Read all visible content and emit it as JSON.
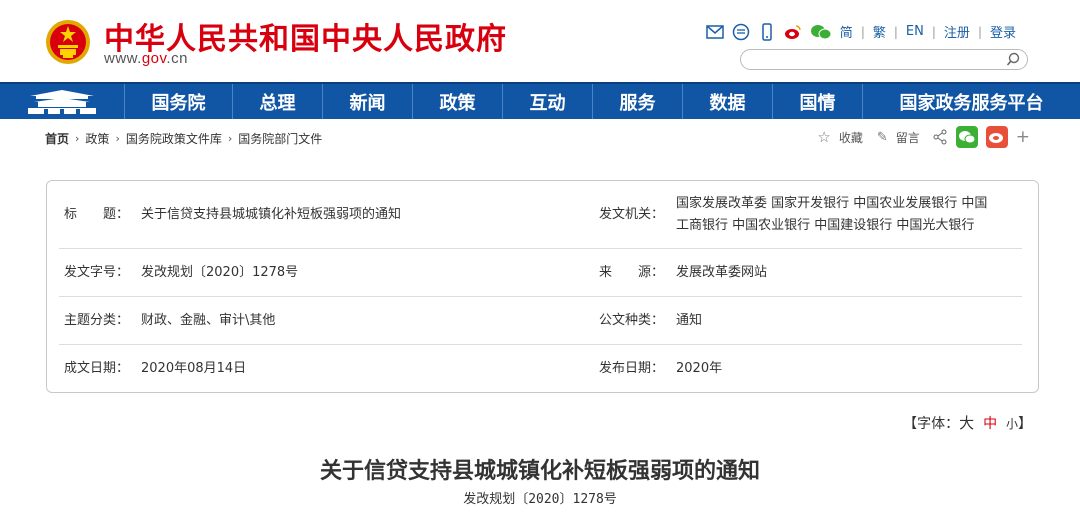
{
  "site": {
    "title": "中华人民共和国中央人民政府",
    "url_prefix": "www.",
    "url_gov": "gov",
    "url_suffix": ".cn",
    "brand_red": "#d8000f",
    "nav_blue": "#1156a5"
  },
  "toplinks": {
    "icons": [
      "mail-icon",
      "message-icon",
      "mobile-icon",
      "weibo-icon",
      "wechat-icon"
    ],
    "simplified": "简",
    "traditional": "繁",
    "english": "EN",
    "register": "注册",
    "login": "登录"
  },
  "search": {
    "placeholder": ""
  },
  "nav": {
    "items": [
      "国务院",
      "总理",
      "新闻",
      "政策",
      "互动",
      "服务",
      "数据",
      "国情",
      "国家政务服务平台"
    ]
  },
  "breadcrumb": [
    "首页",
    "政策",
    "国务院政策文件库",
    "国务院部门文件"
  ],
  "tools": {
    "favorite": "收藏",
    "comment": "留言",
    "plus": "+"
  },
  "info": {
    "title_label": "标　　题：",
    "title_value": "关于信贷支持县城城镇化补短板强弱项的通知",
    "issuer_label": "发文机关：",
    "issuer_line1": "国家发展改革委  国家开发银行  中国农业发展银行  中国",
    "issuer_line2": "工商银行  中国农业银行  中国建设银行  中国光大银行",
    "docno_label": "发文字号：",
    "docno_value": "发改规划〔2020〕1278号",
    "source_label": "来　　源：",
    "source_value": "发展改革委网站",
    "topic_label": "主题分类：",
    "topic_value": "财政、金融、审计\\其他",
    "type_label": "公文种类：",
    "type_value": "通知",
    "date_label": "成文日期：",
    "date_value": "2020年08月14日",
    "pub_label": "发布日期：",
    "pub_value": "2020年"
  },
  "fontsize": {
    "open": "【字体：",
    "big": "大",
    "mid": "中",
    "small": "小",
    "close": "】"
  },
  "article": {
    "title": "关于信贷支持县城城镇化补短板强弱项的通知",
    "number": "发改规划〔2020〕1278号"
  }
}
